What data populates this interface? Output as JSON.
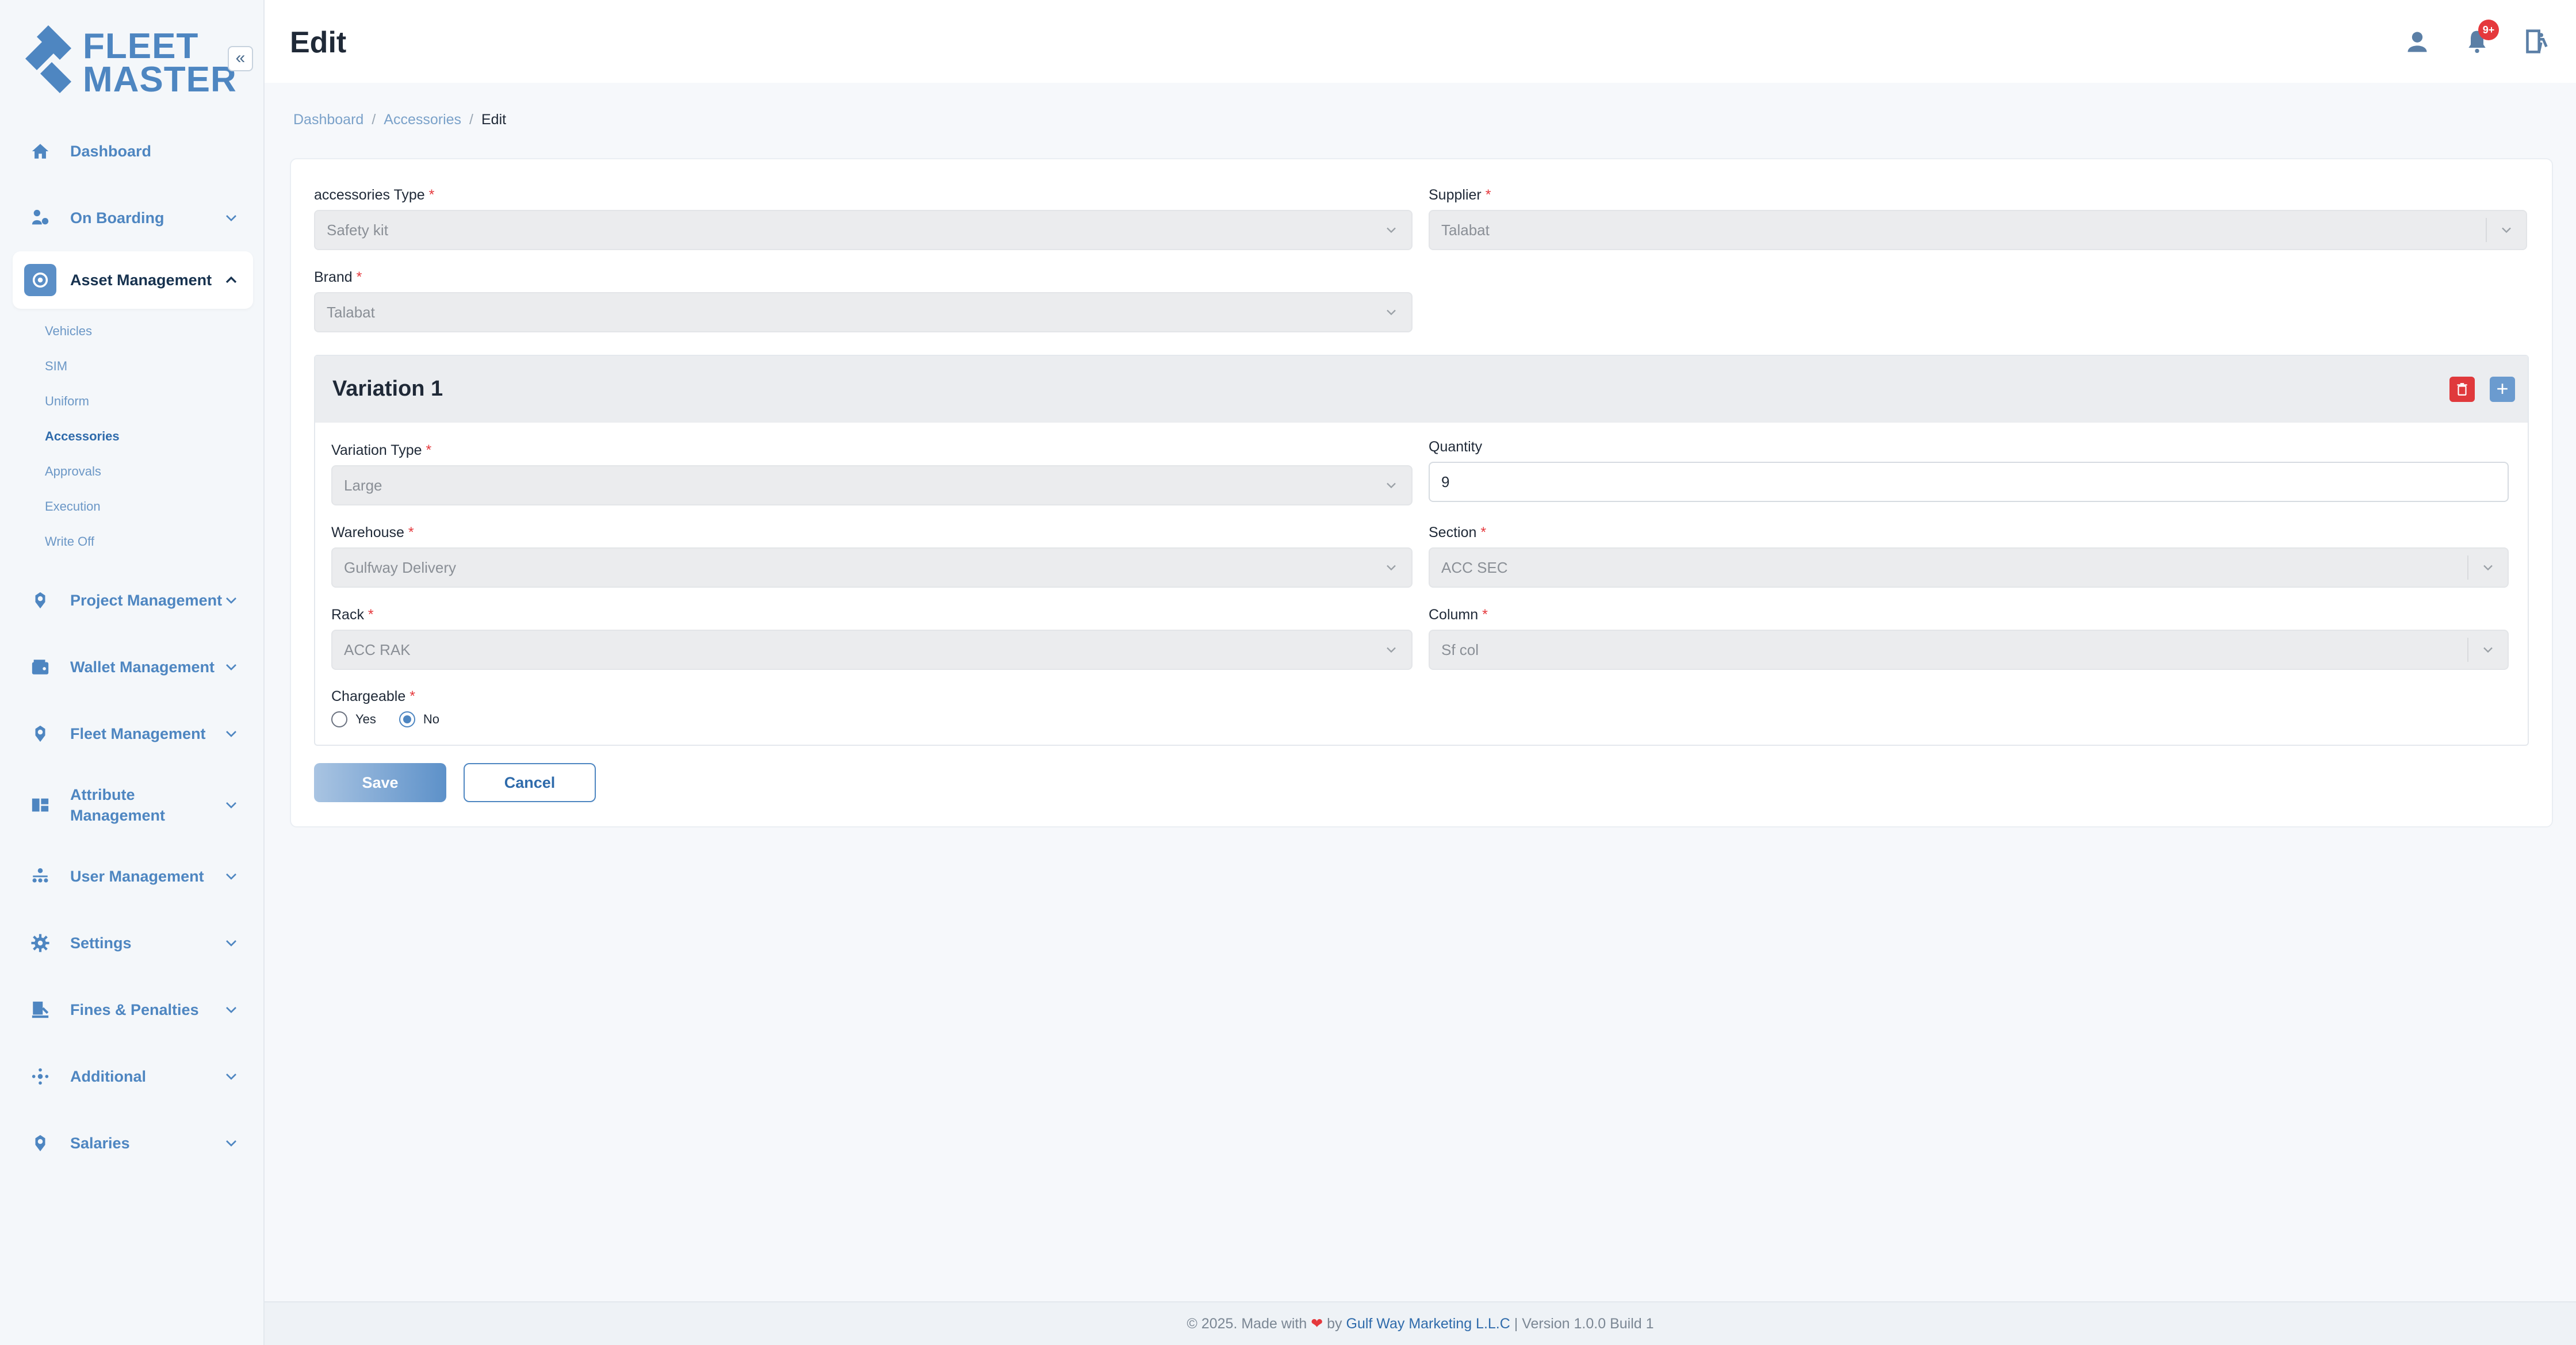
{
  "brand": {
    "line1": "FLEET",
    "line2": "MASTER",
    "accent": "#4e86c1"
  },
  "sidebar": {
    "collapse_icon": "«",
    "items": [
      {
        "label": "Dashboard",
        "icon": "home-icon"
      },
      {
        "label": "On Boarding",
        "icon": "onboarding-icon"
      },
      {
        "label": "Asset Management",
        "icon": "asset-icon",
        "expanded": true,
        "children": [
          "Vehicles",
          "SIM",
          "Uniform",
          "Accessories",
          "Approvals",
          "Execution",
          "Write Off"
        ],
        "active_child": "Accessories"
      },
      {
        "label": "Project Management",
        "icon": "project-icon"
      },
      {
        "label": "Wallet Management",
        "icon": "wallet-icon"
      },
      {
        "label": "Fleet Management",
        "icon": "fleet-icon"
      },
      {
        "label": "Attribute Management",
        "label_line1": "Attribute",
        "label_line2": "Management",
        "icon": "attribute-icon"
      },
      {
        "label": "User Management",
        "icon": "users-icon"
      },
      {
        "label": "Settings",
        "icon": "gear-icon"
      },
      {
        "label": "Fines & Penalties",
        "icon": "fines-icon"
      },
      {
        "label": "Additional",
        "icon": "additional-icon"
      },
      {
        "label": "Salaries",
        "icon": "salaries-icon"
      }
    ]
  },
  "header": {
    "title": "Edit",
    "notification_badge": "9+"
  },
  "breadcrumb": {
    "items": [
      "Dashboard",
      "Accessories"
    ],
    "current": "Edit",
    "separator": "/"
  },
  "form": {
    "accessories_type": {
      "label": "accessories Type",
      "value": "Safety kit"
    },
    "supplier": {
      "label": "Supplier",
      "value": "Talabat"
    },
    "brand": {
      "label": "Brand",
      "value": "Talabat"
    },
    "required_mark": "*",
    "variation": {
      "title": "Variation 1",
      "add_label": "+",
      "variation_type": {
        "label": "Variation Type",
        "value": "Large"
      },
      "quantity": {
        "label": "Quantity",
        "value": "9"
      },
      "warehouse": {
        "label": "Warehouse",
        "value": "Gulfway Delivery"
      },
      "section": {
        "label": "Section",
        "value": "ACC SEC"
      },
      "rack": {
        "label": "Rack",
        "value": "ACC RAK"
      },
      "column": {
        "label": "Column",
        "value": "Sf col"
      },
      "chargeable": {
        "label": "Chargeable",
        "options": [
          "Yes",
          "No"
        ],
        "selected": "No"
      }
    },
    "save_label": "Save",
    "cancel_label": "Cancel"
  },
  "footer": {
    "prefix": "© 2025. Made with",
    "heart": "❤",
    "by": "by",
    "company": "Gulf Way Marketing L.L.C",
    "version": "| Version 1.0.0 Build 1"
  }
}
